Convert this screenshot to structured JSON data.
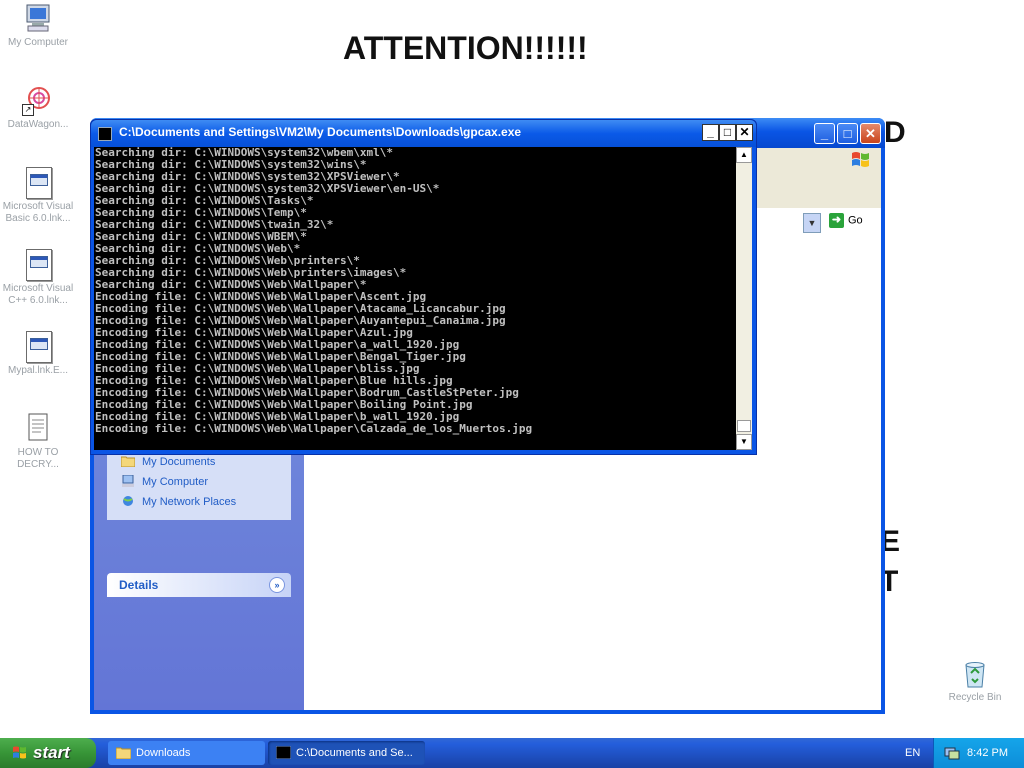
{
  "desktop": {
    "icons": [
      {
        "label": "My Computer"
      },
      {
        "label": "DataWagon..."
      },
      {
        "label": "Microsoft Visual Basic 6.0.lnk..."
      },
      {
        "label": "Microsoft Visual C++ 6.0.lnk..."
      },
      {
        "label": "Mypal.lnk.E..."
      },
      {
        "label": "HOW TO DECRY..."
      },
      {
        "label": "Recycle Bin"
      }
    ],
    "attention": "ATTENTION!!!!!!",
    "frag_d": "D",
    "frag_e": "E",
    "frag_t": "T"
  },
  "explorer": {
    "go_label": "Go",
    "taskpane_items": [
      {
        "label": "My Documents"
      },
      {
        "label": "My Computer"
      },
      {
        "label": "My Network Places"
      }
    ],
    "details_label": "Details"
  },
  "console": {
    "title": "C:\\Documents and Settings\\VM2\\My Documents\\Downloads\\gpcax.exe",
    "lines": [
      "Searching dir: C:\\WINDOWS\\system32\\wbem\\xml\\*",
      "Searching dir: C:\\WINDOWS\\system32\\wins\\*",
      "Searching dir: C:\\WINDOWS\\system32\\XPSViewer\\*",
      "Searching dir: C:\\WINDOWS\\system32\\XPSViewer\\en-US\\*",
      "Searching dir: C:\\WINDOWS\\Tasks\\*",
      "Searching dir: C:\\WINDOWS\\Temp\\*",
      "Searching dir: C:\\WINDOWS\\twain_32\\*",
      "Searching dir: C:\\WINDOWS\\WBEM\\*",
      "Searching dir: C:\\WINDOWS\\Web\\*",
      "Searching dir: C:\\WINDOWS\\Web\\printers\\*",
      "Searching dir: C:\\WINDOWS\\Web\\printers\\images\\*",
      "Searching dir: C:\\WINDOWS\\Web\\Wallpaper\\*",
      "Encoding file: C:\\WINDOWS\\Web\\Wallpaper\\Ascent.jpg",
      "Encoding file: C:\\WINDOWS\\Web\\Wallpaper\\Atacama_Licancabur.jpg",
      "Encoding file: C:\\WINDOWS\\Web\\Wallpaper\\Auyantepui_Canaima.jpg",
      "Encoding file: C:\\WINDOWS\\Web\\Wallpaper\\Azul.jpg",
      "Encoding file: C:\\WINDOWS\\Web\\Wallpaper\\a_wall_1920.jpg",
      "Encoding file: C:\\WINDOWS\\Web\\Wallpaper\\Bengal_Tiger.jpg",
      "Encoding file: C:\\WINDOWS\\Web\\Wallpaper\\bliss.jpg",
      "Encoding file: C:\\WINDOWS\\Web\\Wallpaper\\Blue hills.jpg",
      "Encoding file: C:\\WINDOWS\\Web\\Wallpaper\\Bodrum_CastleStPeter.jpg",
      "Encoding file: C:\\WINDOWS\\Web\\Wallpaper\\Boiling Point.jpg",
      "Encoding file: C:\\WINDOWS\\Web\\Wallpaper\\b_wall_1920.jpg",
      "Encoding file: C:\\WINDOWS\\Web\\Wallpaper\\Calzada_de_los_Muertos.jpg"
    ]
  },
  "taskbar": {
    "start_label": "start",
    "tasks": [
      {
        "label": "Downloads"
      },
      {
        "label": "C:\\Documents and Se..."
      }
    ],
    "language": "EN",
    "clock": "8:42 PM"
  },
  "colors": {
    "xp_blue": "#0a55e5",
    "start_green": "#379537",
    "console_bg": "#000000",
    "console_text": "#c0c0c0"
  }
}
